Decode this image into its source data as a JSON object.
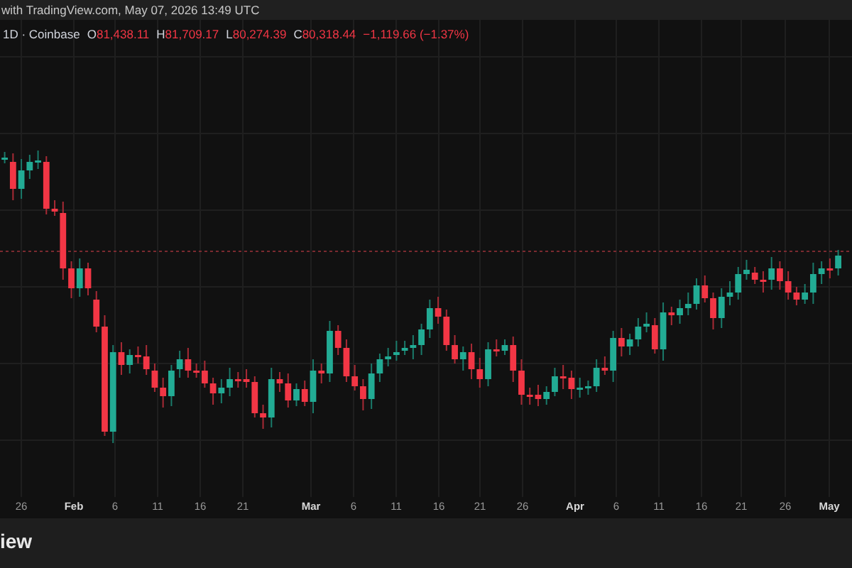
{
  "header": {
    "text": "with TradingView.com, May 07, 2026 13:49 UTC"
  },
  "legend": {
    "symbol": "1D · Coinbase",
    "negative": true,
    "fields": [
      {
        "letter": "O",
        "value": "81,438.11"
      },
      {
        "letter": "H",
        "value": "81,709.17"
      },
      {
        "letter": "L",
        "value": "80,274.39"
      },
      {
        "letter": "C",
        "value": "80,318.44"
      }
    ],
    "change": "−1,119.66 (−1.37%)"
  },
  "x_axis": {
    "labels": [
      {
        "text": "26",
        "kind": "day"
      },
      {
        "text": "Feb",
        "kind": "month"
      },
      {
        "text": "6",
        "kind": "day"
      },
      {
        "text": "11",
        "kind": "day"
      },
      {
        "text": "16",
        "kind": "day"
      },
      {
        "text": "21",
        "kind": "day"
      },
      {
        "text": "Mar",
        "kind": "month"
      },
      {
        "text": "6",
        "kind": "day"
      },
      {
        "text": "11",
        "kind": "day"
      },
      {
        "text": "16",
        "kind": "day"
      },
      {
        "text": "21",
        "kind": "day"
      },
      {
        "text": "26",
        "kind": "day"
      },
      {
        "text": "Apr",
        "kind": "month"
      },
      {
        "text": "6",
        "kind": "day"
      },
      {
        "text": "11",
        "kind": "day"
      },
      {
        "text": "16",
        "kind": "day"
      },
      {
        "text": "21",
        "kind": "day"
      },
      {
        "text": "26",
        "kind": "day"
      },
      {
        "text": "May",
        "kind": "month"
      }
    ]
  },
  "footer": {
    "text": "iew"
  }
}
